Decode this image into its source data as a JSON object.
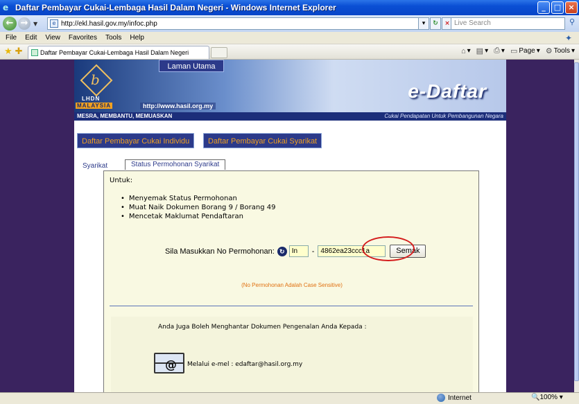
{
  "window": {
    "title": "Daftar Pembayar Cukai-Lembaga Hasil Dalam Negeri - Windows Internet Explorer",
    "controls": [
      "minimize",
      "maximize",
      "close"
    ]
  },
  "addressbar": {
    "url": "http://ekl.hasil.gov.my/infoc.php",
    "search_placeholder": "Live Search"
  },
  "menubar": {
    "items": [
      "File",
      "Edit",
      "View",
      "Favorites",
      "Tools",
      "Help"
    ]
  },
  "tabbar": {
    "tab_title": "Daftar Pembayar Cukai-Lembaga Hasil Dalam Negeri",
    "commands": [
      "Page",
      "Tools"
    ]
  },
  "site": {
    "home_link": "Laman Utama",
    "logo_text": "LHDN",
    "logo_country": "MALAYSIA",
    "banner_url": "http://www.hasil.org.my",
    "brand": "e-Daftar",
    "motto": "MESRA, MEMBANTU, MEMUASKAN",
    "tagline": "Cukai Pendapatan Untuk Pembangunan Negara",
    "nav": [
      "Daftar Pembayar Cukai Individu",
      "Daftar Pembayar Cukai Syarikat"
    ],
    "subtabs": [
      "Syarikat",
      "Status Permohonan Syarikat"
    ]
  },
  "panel": {
    "intro": "Untuk:",
    "bullets": [
      "Menyemak Status Permohonan",
      "Muat Naik Dokumen Borang 9 / Borang 49",
      "Mencetak Maklumat Pendaftaran"
    ],
    "form_label": "Sila Masukkan No Permohonan:",
    "prefix_value": "In",
    "dash": "-",
    "code_value": "4862ea23ccc1a",
    "submit_label": "Semak",
    "case_note": "(No Permohonan Adalah Case Sensitive)",
    "lower_heading": "Anda Juga Boleh Menghantar Dokumen Pengenalan Anda Kepada :",
    "email_line": "Melalui e-mel : edaftar@hasil.org.my"
  },
  "statusbar": {
    "zone": "Internet",
    "zoom": "100%"
  }
}
